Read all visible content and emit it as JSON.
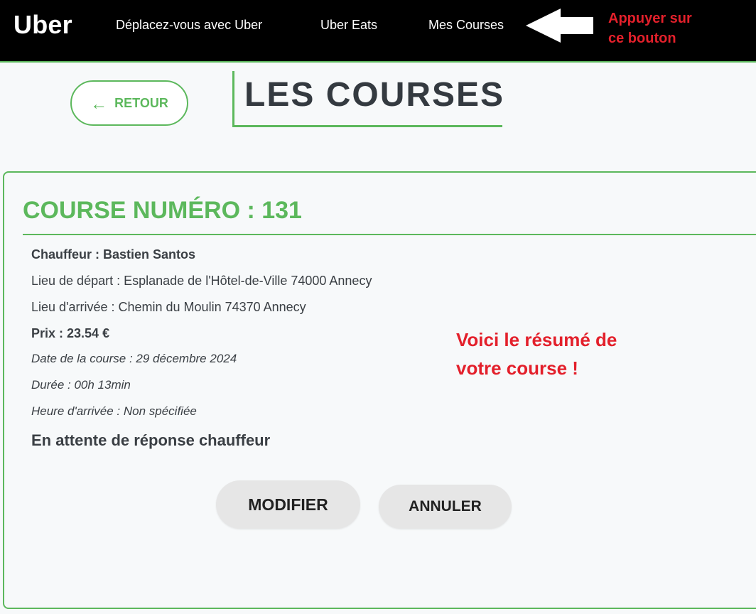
{
  "colors": {
    "accent": "#5cb85c",
    "annotation": "#e3202b",
    "navbar": "#000000",
    "text": "#3a3f44"
  },
  "navbar": {
    "logo": "Uber",
    "links": [
      "Déplacez-vous avec Uber",
      "Uber Eats",
      "Mes Courses"
    ]
  },
  "annotations": {
    "arrow_icon": "arrow-left-icon",
    "top_line1": "Appuyer sur",
    "top_line2": "ce bouton",
    "card_line1": "Voici le résumé de",
    "card_line2": "votre course !"
  },
  "header": {
    "back_label": "RETOUR",
    "back_icon": "arrow-left-icon",
    "title": "LES COURSES"
  },
  "course": {
    "title": "COURSE NUMÉRO : 131",
    "driver": "Chauffeur : Bastien Santos",
    "departure": "Lieu de départ : Esplanade de l'Hôtel-de-Ville 74000 Annecy",
    "arrival": "Lieu d'arrivée : Chemin du Moulin 74370 Annecy",
    "price": "Prix : 23.54 €",
    "date": "Date de la course : 29 décembre 2024",
    "duration": "Durée : 00h 13min",
    "arrival_time": "Heure d'arrivée : Non spécifiée",
    "status": "En attente de réponse chauffeur",
    "modify_label": "MODIFIER",
    "cancel_label": "ANNULER"
  }
}
